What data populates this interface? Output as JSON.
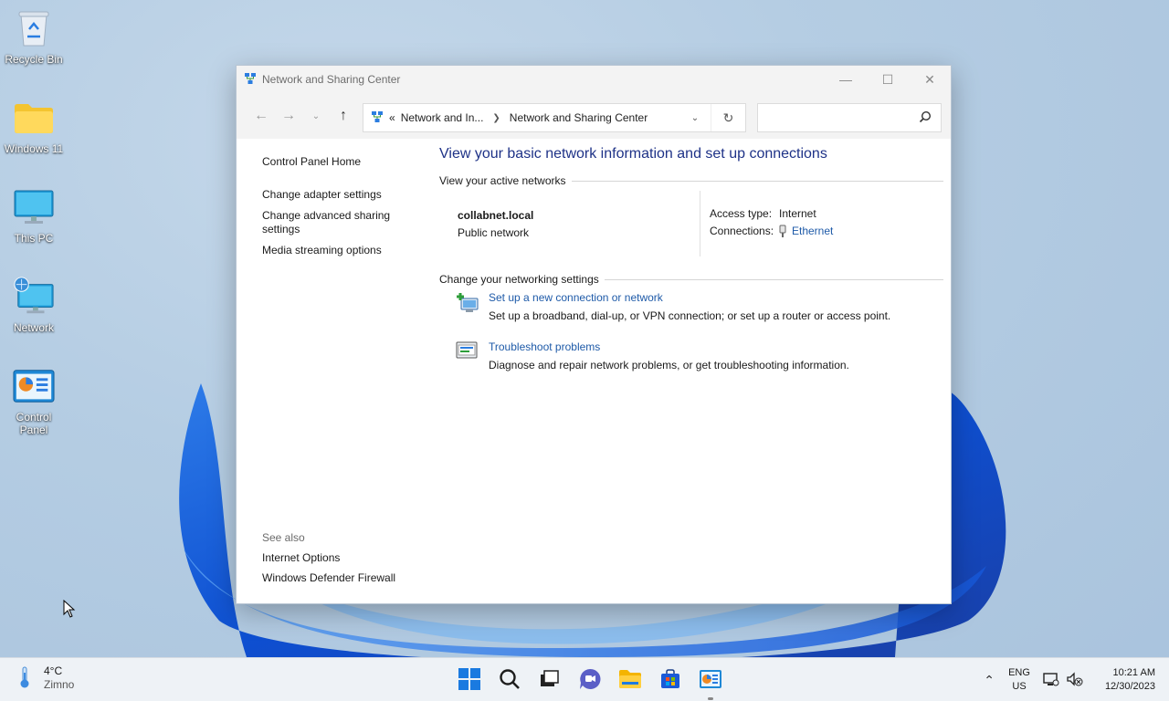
{
  "desktop": {
    "icons": [
      {
        "label": "Recycle Bin",
        "icon": "recycle-bin-icon"
      },
      {
        "label": "Windows 11",
        "icon": "folder-icon"
      },
      {
        "label": "This PC",
        "icon": "monitor-icon"
      },
      {
        "label": "Network",
        "icon": "network-icon"
      },
      {
        "label": "Control Panel",
        "icon": "control-panel-icon"
      }
    ]
  },
  "window": {
    "title": "Network and Sharing Center",
    "address": {
      "crumbs": [
        "Network and In...",
        "Network and Sharing Center"
      ],
      "prefix": "«"
    },
    "search": {
      "placeholder": ""
    },
    "left_pane": {
      "home": "Control Panel Home",
      "links": [
        "Change adapter settings",
        "Change advanced sharing settings",
        "Media streaming options"
      ],
      "see_also_header": "See also",
      "see_also": [
        "Internet Options",
        "Windows Defender Firewall"
      ]
    },
    "main": {
      "heading": "View your basic network information and set up connections",
      "active_networks_header": "View your active networks",
      "network": {
        "name": "collabnet.local",
        "type": "Public network",
        "access_type_label": "Access type:",
        "access_type_value": "Internet",
        "connections_label": "Connections:",
        "connections_value": "Ethernet"
      },
      "change_settings_header": "Change your networking settings",
      "tasks": [
        {
          "title": "Set up a new connection or network",
          "desc": "Set up a broadband, dial-up, or VPN connection; or set up a router or access point.",
          "icon": "new-connection-icon"
        },
        {
          "title": "Troubleshoot problems",
          "desc": "Diagnose and repair network problems, or get troubleshooting information.",
          "icon": "troubleshoot-icon"
        }
      ]
    }
  },
  "taskbar": {
    "weather": {
      "temp": "4°C",
      "condition": "Zimno"
    },
    "apps": [
      "start-icon",
      "search-icon",
      "task-view-icon",
      "chat-icon",
      "file-explorer-icon",
      "store-icon",
      "control-panel-icon"
    ],
    "lang": {
      "line1": "ENG",
      "line2": "US"
    },
    "clock": {
      "time": "10:21 AM",
      "date": "12/30/2023"
    }
  },
  "colors": {
    "accent": "#1e5aa8",
    "heading": "#1e3287",
    "win_blue": "#1a63d6"
  }
}
